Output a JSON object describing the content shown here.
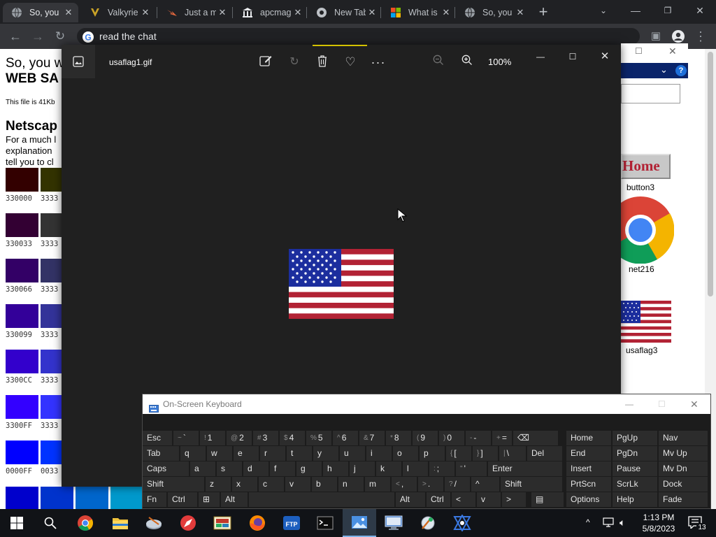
{
  "browser": {
    "tabs": [
      {
        "title": "So, you",
        "icon": "globe-icon"
      },
      {
        "title": "Valkyrie",
        "icon": "valkyrie-icon"
      },
      {
        "title": "Just a m",
        "icon": "maker-icon"
      },
      {
        "title": "apcmag",
        "icon": "museum-icon"
      },
      {
        "title": "New Tab",
        "icon": "chrome-icon"
      },
      {
        "title": "What is",
        "icon": "microsoft-icon"
      },
      {
        "title": "So, you",
        "icon": "globe-icon"
      }
    ],
    "omnibox_text": "read the chat"
  },
  "webpage": {
    "heading_line1": "So, you w",
    "heading_line2": "WEB SA",
    "file_note": "This file is 41Kb",
    "section_title": "Netscap",
    "body_line1": "For a much l",
    "body_line2": "explanation",
    "body_line3": "tell you to cl",
    "swatches": [
      {
        "label": "330000",
        "label2": "3333",
        "color1": "#330000",
        "color2": "#333300"
      },
      {
        "label": "330033",
        "label2": "3333",
        "color1": "#330033",
        "color2": "#333333"
      },
      {
        "label": "330066",
        "label2": "3333",
        "color1": "#330066",
        "color2": "#333366"
      },
      {
        "label": "330099",
        "label2": "3333",
        "color1": "#330099",
        "color2": "#333399"
      },
      {
        "label": "3300CC",
        "label2": "3333",
        "color1": "#3300CC",
        "color2": "#3333CC"
      },
      {
        "label": "3300FF",
        "label2": "3333",
        "color1": "#3300FF",
        "color2": "#3333FF"
      },
      {
        "label": "0000FF",
        "label2": "0033",
        "color1": "#0000FF",
        "color2": "#0033FF"
      }
    ],
    "desktop_labels": {
      "button3": "button3",
      "net216": "net216",
      "usaflag3": "usaflag3",
      "home_button": "Home"
    }
  },
  "photos": {
    "filename": "usaflag1.gif",
    "zoom": "100%"
  },
  "osk": {
    "title": "On-Screen Keyboard",
    "rows": [
      [
        {
          "l": "Esc"
        },
        {
          "s": "~",
          "l": "`"
        },
        {
          "s": "!",
          "l": "1"
        },
        {
          "s": "@",
          "l": "2"
        },
        {
          "s": "#",
          "l": "3"
        },
        {
          "s": "$",
          "l": "4"
        },
        {
          "s": "%",
          "l": "5"
        },
        {
          "s": "^",
          "l": "6"
        },
        {
          "s": "&",
          "l": "7"
        },
        {
          "s": "*",
          "l": "8"
        },
        {
          "s": "(",
          "l": "9"
        },
        {
          "s": ")",
          "l": "0"
        },
        {
          "s": "-",
          "l": "-"
        },
        {
          "s": "+",
          "l": "="
        },
        {
          "l": "⌫"
        },
        {
          "l": "Home"
        },
        {
          "l": "PgUp"
        },
        {
          "l": "Nav"
        }
      ],
      [
        {
          "l": "Tab"
        },
        {
          "l": "q"
        },
        {
          "l": "w"
        },
        {
          "l": "e"
        },
        {
          "l": "r"
        },
        {
          "l": "t"
        },
        {
          "l": "y"
        },
        {
          "l": "u"
        },
        {
          "l": "i"
        },
        {
          "l": "o"
        },
        {
          "l": "p"
        },
        {
          "s": "{",
          "l": "["
        },
        {
          "s": "}",
          "l": "]"
        },
        {
          "s": "|",
          "l": "\\"
        },
        {
          "l": "Del"
        },
        {
          "l": "End"
        },
        {
          "l": "PgDn"
        },
        {
          "l": "Mv Up"
        }
      ],
      [
        {
          "l": "Caps"
        },
        {
          "l": "a"
        },
        {
          "l": "s"
        },
        {
          "l": "d"
        },
        {
          "l": "f"
        },
        {
          "l": "g"
        },
        {
          "l": "h"
        },
        {
          "l": "j"
        },
        {
          "l": "k"
        },
        {
          "l": "l"
        },
        {
          "s": ":",
          "l": ";"
        },
        {
          "s": "\"",
          "l": "'"
        },
        {
          "l": "Enter"
        },
        {
          "l": "Insert"
        },
        {
          "l": "Pause"
        },
        {
          "l": "Mv Dn"
        }
      ],
      [
        {
          "l": "Shift"
        },
        {
          "l": "z"
        },
        {
          "l": "x"
        },
        {
          "l": "c"
        },
        {
          "l": "v"
        },
        {
          "l": "b"
        },
        {
          "l": "n"
        },
        {
          "l": "m"
        },
        {
          "s": "<",
          "l": ","
        },
        {
          "s": ">",
          "l": "."
        },
        {
          "s": "?",
          "l": "/"
        },
        {
          "l": "^"
        },
        {
          "l": "Shift"
        },
        {
          "l": "PrtScn"
        },
        {
          "l": "ScrLk"
        },
        {
          "l": "Dock"
        }
      ],
      [
        {
          "l": "Fn"
        },
        {
          "l": "Ctrl"
        },
        {
          "l": "⊞"
        },
        {
          "l": "Alt"
        },
        {
          "l": ""
        },
        {
          "l": "Alt"
        },
        {
          "l": "Ctrl"
        },
        {
          "l": "<"
        },
        {
          "l": "v"
        },
        {
          "l": ">"
        },
        {
          "l": "▤"
        },
        {
          "l": "Options"
        },
        {
          "l": "Help"
        },
        {
          "l": "Fade"
        }
      ]
    ]
  },
  "taskbar": {
    "time": "1:13 PM",
    "date": "5/8/2023",
    "notification_count": "13"
  }
}
